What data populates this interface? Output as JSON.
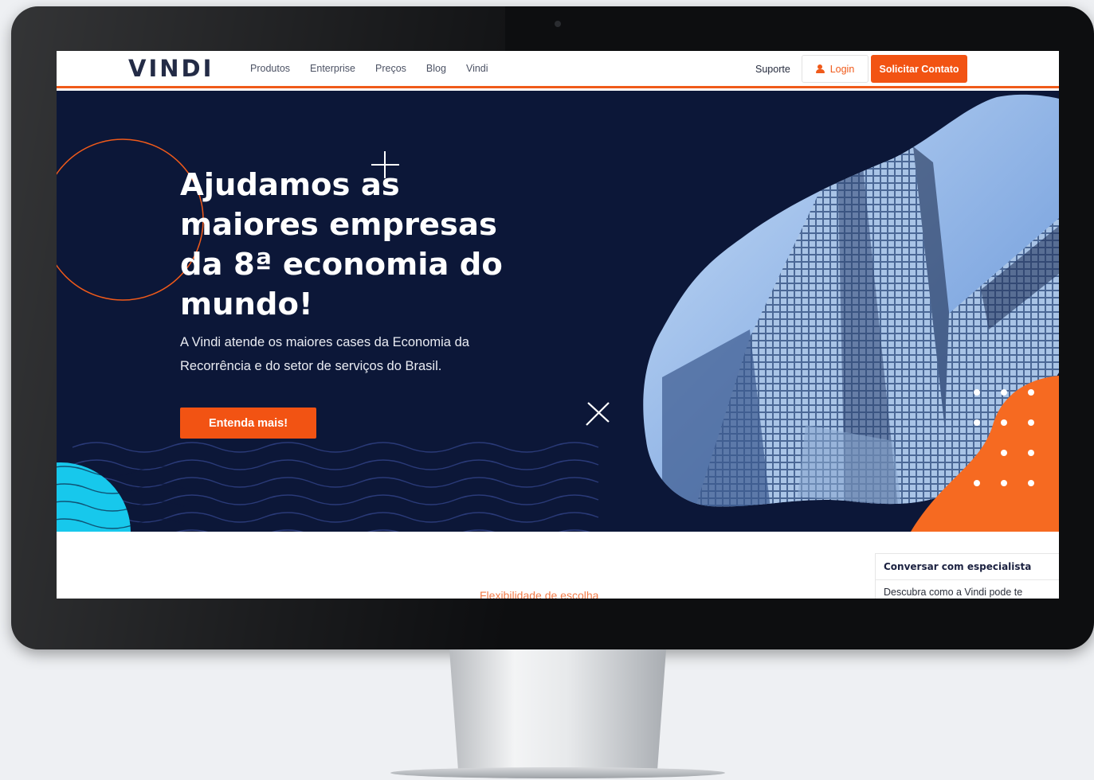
{
  "nav": {
    "logo": "VINDI",
    "links": [
      "Produtos",
      "Enterprise",
      "Preços",
      "Blog",
      "Vindi"
    ],
    "support": "Suporte",
    "login": "Login",
    "contact": "Solicitar Contato"
  },
  "hero": {
    "title": "Ajudamos as maiores empresas da 8ª economia do mundo!",
    "subtitle": "A Vindi atende os maiores cases da Economia da Recorrência e do setor de serviços do Brasil.",
    "cta": "Entenda mais!"
  },
  "section": {
    "label": "Flexibilidade de escolha"
  },
  "chat": {
    "title": "Conversar com especialista",
    "text": "Descubra como a Vindi pode te"
  },
  "icons": [
    "user-icon",
    "building-image",
    "plus-icon",
    "x-icon",
    "wave-pattern",
    "dot-grid"
  ],
  "colors": {
    "brand_orange": "#f25313",
    "hero_navy": "#0c1738",
    "accent_cyan": "#17c8ec",
    "logo_navy": "#232b46"
  }
}
